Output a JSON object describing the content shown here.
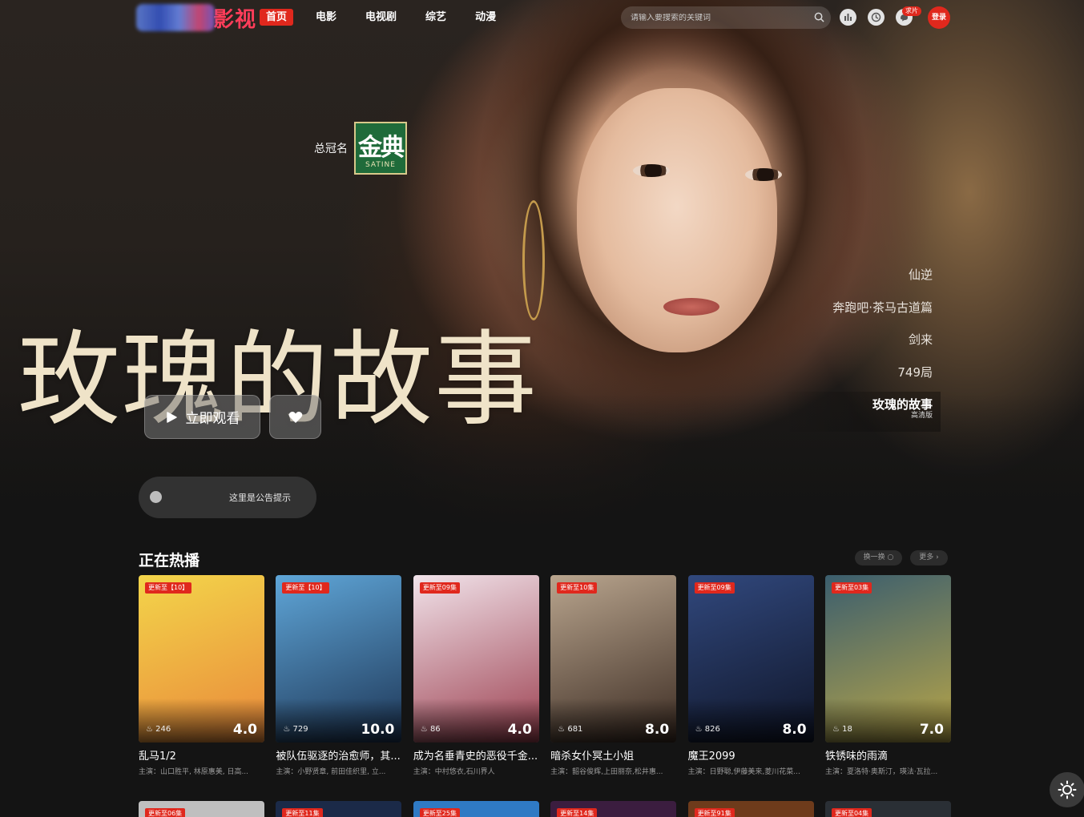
{
  "nav": {
    "logo_text": "影视",
    "items": [
      "首页",
      "电影",
      "电视剧",
      "综艺",
      "动漫"
    ],
    "search_placeholder": "请输入要搜索的关键词",
    "request_badge": "求片",
    "login_label": "登录"
  },
  "hero": {
    "sponsor_label": "总冠名",
    "sponsor_brand": "金典",
    "sponsor_brand_en": "SATINE",
    "title": "玫瑰的故事",
    "play_label": "立即观看",
    "notice": "这里是公告提示",
    "slides": [
      {
        "title": "仙逆",
        "sub": ""
      },
      {
        "title": "奔跑吧·茶马古道篇",
        "sub": ""
      },
      {
        "title": "剑来",
        "sub": ""
      },
      {
        "title": "749局",
        "sub": ""
      },
      {
        "title": "玫瑰的故事",
        "sub": "高清版",
        "active": true
      }
    ]
  },
  "hot": {
    "title": "正在热播",
    "swap_label": "换一换",
    "more_label": "更多",
    "items": [
      {
        "tag": "更新至【10】",
        "heat": "246",
        "score": "4.0",
        "name": "乱马1/2",
        "cast": "主演：山口胜平, 林原惠美, 日高...",
        "color1": "#f3d54a",
        "color2": "#e9883a"
      },
      {
        "tag": "更新至【10】",
        "heat": "729",
        "score": "10.0",
        "name": "被队伍驱逐的治愈师，其...",
        "cast": "主演：小野贤章, 前田佳织里, 立...",
        "color1": "#5fa6d8",
        "color2": "#1d3555"
      },
      {
        "tag": "更新至09集",
        "heat": "86",
        "score": "4.0",
        "name": "成为名垂青史的恶役千金...",
        "cast": "主演：中村悠衣,石川界人",
        "color1": "#f1e3ea",
        "color2": "#9c3f4f"
      },
      {
        "tag": "更新至10集",
        "heat": "681",
        "score": "8.0",
        "name": "暗杀女仆冥土小姐",
        "cast": "主演：韶谷俊辉,上田丽奈,松井惠...",
        "color1": "#b9a58e",
        "color2": "#3b2b22"
      },
      {
        "tag": "更新至09集",
        "heat": "826",
        "score": "8.0",
        "name": "魔王2099",
        "cast": "主演：日野聪,伊藤美来,菱川花菜...",
        "color1": "#31487d",
        "color2": "#0f1528"
      },
      {
        "tag": "更新至03集",
        "heat": "18",
        "score": "7.0",
        "name": "铁锈味的雨滴",
        "cast": "主演：夏洛特·奥斯汀，瑛法·瓦拉...",
        "color1": "#3b5e6e",
        "color2": "#b9a648"
      }
    ],
    "row2_tags": [
      "更新至06集",
      "更新至11集",
      "更新至25集",
      "更新至14集",
      "更新至91集",
      "更新至04集"
    ],
    "row2_colors": [
      "#bfbfbf",
      "#1b2a48",
      "#2f7ac4",
      "#3b1d3f",
      "#6e3b1b",
      "#2a2f35"
    ]
  }
}
